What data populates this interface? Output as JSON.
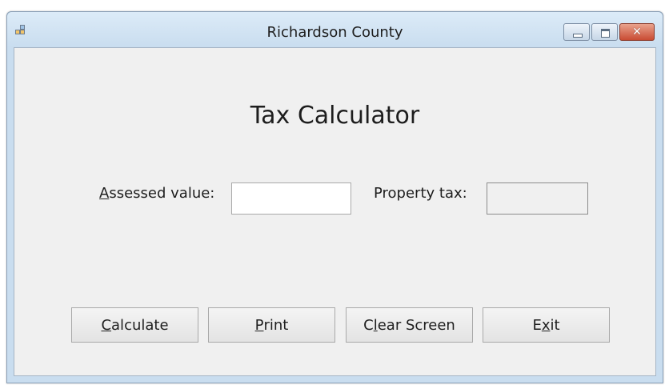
{
  "window": {
    "title": "Richardson County",
    "app_icon": "app-icon",
    "controls": {
      "minimize_icon": "minimize-icon",
      "maximize_icon": "maximize-icon",
      "close_icon": "close-icon",
      "close_glyph": "✕"
    }
  },
  "form": {
    "title": "Tax Calculator",
    "assessed_value": {
      "label_prefix": "",
      "label_accel": "A",
      "label_rest": "ssessed value:",
      "value": ""
    },
    "property_tax": {
      "label": "Property tax:",
      "value": ""
    }
  },
  "buttons": {
    "calculate": {
      "accel": "C",
      "rest": "alculate",
      "prefix": ""
    },
    "print": {
      "accel": "P",
      "rest": "rint",
      "prefix": ""
    },
    "clear_screen": {
      "prefix": "C",
      "accel": "l",
      "rest": "ear Screen"
    },
    "exit": {
      "prefix": "E",
      "accel": "x",
      "rest": "it"
    }
  },
  "colors": {
    "frame": "#c9ddef",
    "client": "#f0f0f0",
    "close_button": "#c94b33"
  }
}
